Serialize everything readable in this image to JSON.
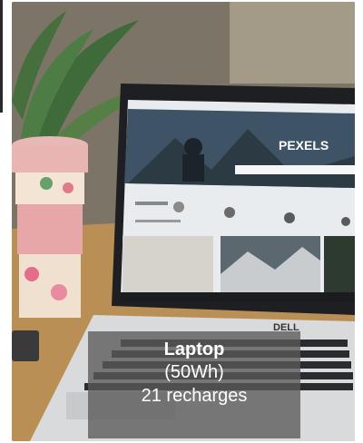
{
  "product": {
    "name": "Laptop",
    "capacity": "(50Wh)",
    "recharges": "21 recharges"
  },
  "screen": {
    "brand_banner": "PEXELS",
    "laptop_logo": "DELL"
  },
  "colors": {
    "overlay": "#5a5a5a",
    "text": "#ffffff"
  }
}
